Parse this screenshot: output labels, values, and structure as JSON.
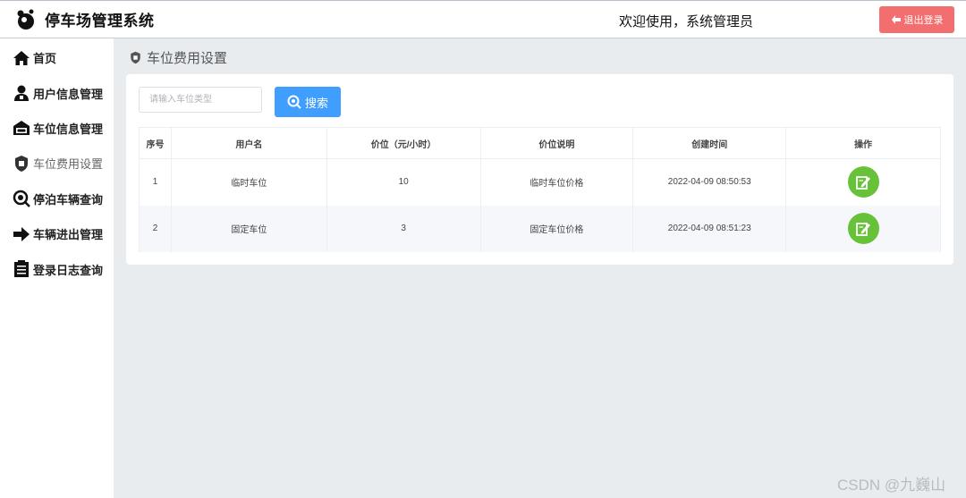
{
  "header": {
    "app_title": "停车场管理系统",
    "welcome": "欢迎使用，系统管理员",
    "logout_label": "退出登录"
  },
  "sidebar": {
    "items": [
      {
        "label": "首页",
        "icon": "home-icon"
      },
      {
        "label": "用户信息管理",
        "icon": "user-icon"
      },
      {
        "label": "车位信息管理",
        "icon": "garage-icon"
      },
      {
        "label": "车位费用设置",
        "icon": "shield-icon",
        "active": true
      },
      {
        "label": "停泊车辆查询",
        "icon": "search-icon"
      },
      {
        "label": "车辆进出管理",
        "icon": "arrow-right-icon"
      },
      {
        "label": "登录日志查询",
        "icon": "document-icon"
      }
    ]
  },
  "main": {
    "page_title": "车位费用设置",
    "search": {
      "placeholder": "请输入车位类型",
      "value": "",
      "button_label": "搜索"
    },
    "table": {
      "columns": [
        "序号",
        "用户名",
        "价位（元/小时）",
        "价位说明",
        "创建时间",
        "操作"
      ],
      "rows": [
        {
          "index": "1",
          "name": "临时车位",
          "price": "10",
          "desc": "临时车位价格",
          "created": "2022-04-09 08:50:53"
        },
        {
          "index": "2",
          "name": "固定车位",
          "price": "3",
          "desc": "固定车位价格",
          "created": "2022-04-09 08:51:23"
        }
      ]
    }
  },
  "watermark": "CSDN @九巍山",
  "colors": {
    "logout": "#f36f6f",
    "primary": "#409eff",
    "edit": "#67c23a"
  }
}
